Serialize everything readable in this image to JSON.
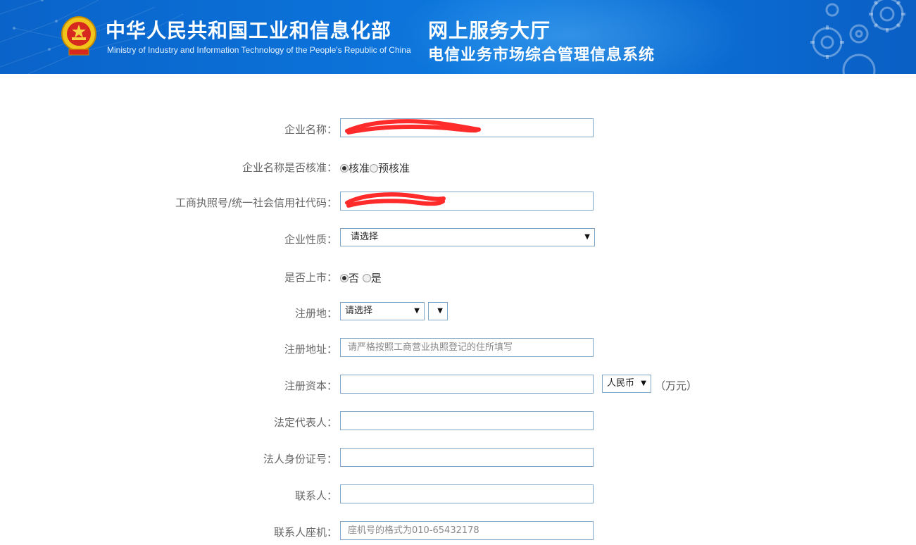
{
  "header": {
    "title_cn": "中华人民共和国工业和信息化部",
    "title_en": "Ministry of Industry and Information Technology of the People's Republic of China",
    "hall": "网上服务大厅",
    "system": "电信业务市场综合管理信息系统"
  },
  "form": {
    "company_name": {
      "label": "企业名称：",
      "value": ""
    },
    "name_approved": {
      "label": "企业名称是否核准：",
      "options": [
        "核准",
        "预核准"
      ],
      "selected": "核准"
    },
    "license_code": {
      "label": "工商执照号/统一社会信用社代码：",
      "value": ""
    },
    "company_type": {
      "label": "企业性质：",
      "selected": "请选择"
    },
    "listed": {
      "label": "是否上市：",
      "options": [
        "否",
        "是"
      ],
      "selected": "否"
    },
    "reg_place": {
      "label": "注册地：",
      "province": "请选择",
      "city": ""
    },
    "reg_address": {
      "label": "注册地址：",
      "placeholder": "请严格按照工商营业执照登记的住所填写"
    },
    "reg_capital": {
      "label": "注册资本：",
      "value": "",
      "currency": "人民币",
      "unit": "（万元）"
    },
    "legal_rep": {
      "label": "法定代表人：",
      "value": ""
    },
    "legal_id": {
      "label": "法人身份证号：",
      "value": ""
    },
    "contact": {
      "label": "联系人：",
      "value": ""
    },
    "contact_phone": {
      "label": "联系人座机：",
      "placeholder": "座机号的格式为010-65432178"
    }
  },
  "colors": {
    "banner": "#0b6fd6",
    "input_border": "#7fa6c8",
    "redaction": "#ff2a2a"
  }
}
